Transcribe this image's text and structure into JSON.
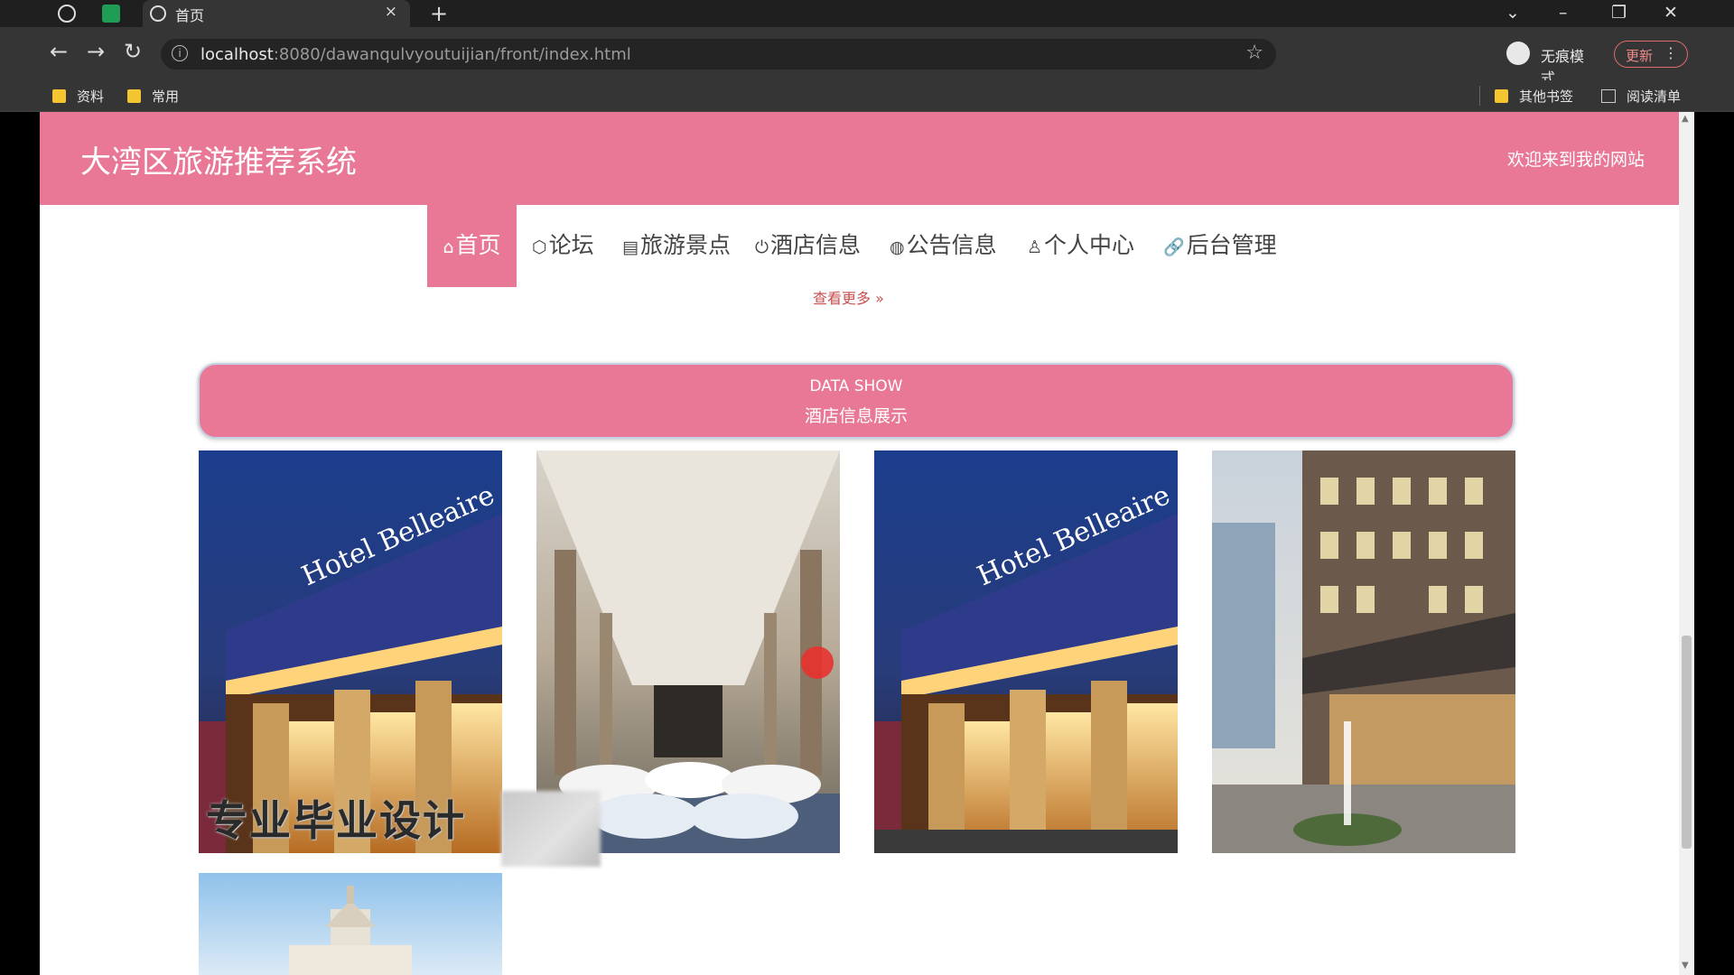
{
  "browser": {
    "tab_title": "首页",
    "tab_close": "×",
    "new_tab": "+",
    "url_host": "localhost",
    "url_rest": ":8080/dawanqulvyoutuijian/front/index.html",
    "incognito_label": "无痕模式",
    "update_label": "更新",
    "bookmarks": [
      "资料",
      "常用"
    ],
    "other_bookmarks": "其他书签",
    "reading_list": "阅读清单"
  },
  "site": {
    "title": "大湾区旅游推荐系统",
    "welcome": "欢迎来到我的网站"
  },
  "nav": {
    "items": [
      "首页",
      "论坛",
      "旅游景点",
      "酒店信息",
      "公告信息",
      "个人中心",
      "后台管理"
    ],
    "more": "查看更多"
  },
  "section": {
    "en": "DATA SHOW",
    "zh": "酒店信息展示"
  },
  "cards": {
    "hotel_sign": "Hotel Belleaire",
    "watermark": "专业毕业设计"
  },
  "colors": {
    "accent_pink": "#e87895",
    "link_red": "#c7504f"
  }
}
